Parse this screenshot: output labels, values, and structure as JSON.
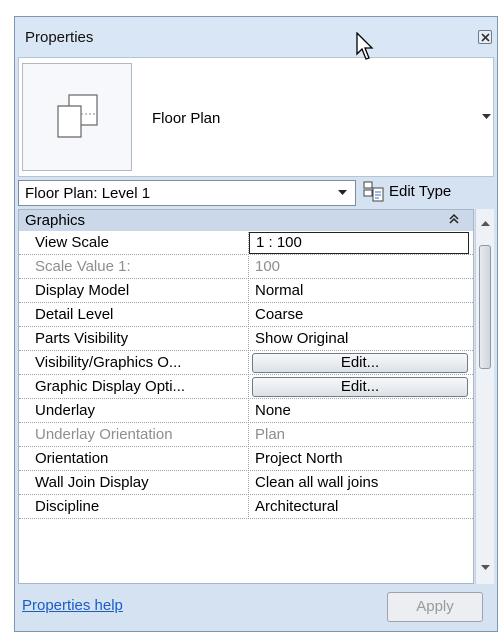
{
  "panel": {
    "title": "Properties",
    "close_icon": "close-icon"
  },
  "type_selector": {
    "name": "Floor Plan",
    "preview_icon": "floor-plan-icon",
    "dropdown_icon": "chevron-down-icon"
  },
  "instance_filter": {
    "selected": "Floor Plan: Level 1"
  },
  "edit_type": {
    "label": "Edit Type",
    "icon": "edit-type-icon"
  },
  "group": {
    "label": "Graphics",
    "collapse_icon": "double-chevron-up-icon"
  },
  "rows": [
    {
      "name": "View Scale",
      "value": "1 : 100",
      "kind": "input"
    },
    {
      "name": "Scale Value    1:",
      "value": "100",
      "kind": "disabled"
    },
    {
      "name": "Display Model",
      "value": "Normal",
      "kind": "value"
    },
    {
      "name": "Detail Level",
      "value": "Coarse",
      "kind": "value"
    },
    {
      "name": "Parts Visibility",
      "value": "Show Original",
      "kind": "value"
    },
    {
      "name": "Visibility/Graphics O...",
      "value": "Edit...",
      "kind": "button"
    },
    {
      "name": "Graphic Display Opti...",
      "value": "Edit...",
      "kind": "button"
    },
    {
      "name": "Underlay",
      "value": "None",
      "kind": "value"
    },
    {
      "name": "Underlay Orientation",
      "value": "Plan",
      "kind": "disabled"
    },
    {
      "name": "Orientation",
      "value": "Project North",
      "kind": "value"
    },
    {
      "name": "Wall Join Display",
      "value": "Clean all wall joins",
      "kind": "value"
    },
    {
      "name": "Discipline",
      "value": "Architectural",
      "kind": "value"
    }
  ],
  "footer": {
    "help_link": "Properties help",
    "apply_label": "Apply"
  },
  "colors": {
    "panel_bg": "#d4e2f2",
    "group_header": "#cad8ea",
    "link": "#1a5dc4",
    "disabled_text": "#8e8e8e"
  }
}
